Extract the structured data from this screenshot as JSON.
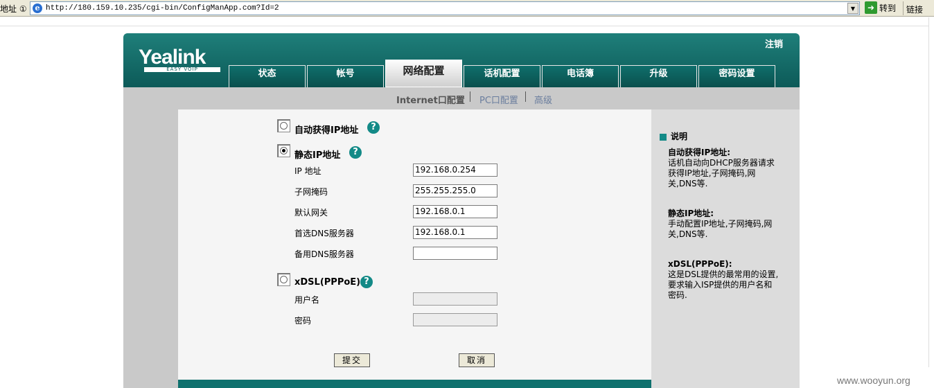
{
  "browser": {
    "address_label": "地址 ①",
    "url": "http://180.159.10.235/cgi-bin/ConfigManApp.com?Id=2",
    "go_label": "转到",
    "links_label": "链接"
  },
  "header": {
    "logo": "Yealink",
    "logo_sub": "EASY VOIP",
    "logout": "注销"
  },
  "tabs": [
    "状态",
    "帐号",
    "网络配置",
    "话机配置",
    "电话簿",
    "升级",
    "密码设置"
  ],
  "subnav": {
    "items": [
      "Internet口配置",
      "PC口配置",
      "高级"
    ],
    "current": "Internet口配置"
  },
  "form": {
    "dhcp_label": "自动获得IP地址",
    "static_label": "静态IP地址",
    "selected_mode": "static",
    "ip_label": "IP 地址",
    "ip_value": "192.168.0.254",
    "mask_label": "子网掩码",
    "mask_value": "255.255.255.0",
    "gateway_label": "默认网关",
    "gateway_value": "192.168.0.1",
    "dns1_label": "首选DNS服务器",
    "dns1_value": "192.168.0.1",
    "dns2_label": "备用DNS服务器",
    "dns2_value": "",
    "pppoe_label": "xDSL(PPPoE)",
    "user_label": "用户名",
    "user_value": "",
    "pass_label": "密码",
    "pass_value": "",
    "submit_label": "提交",
    "cancel_label": "取消",
    "help_glyph": "?"
  },
  "help_panel": {
    "title": "说明",
    "sections": [
      {
        "head": "自动获得IP地址:",
        "body": "话机自动向DHCP服务器请求获得IP地址,子网掩码,网关,DNS等."
      },
      {
        "head": "静态IP地址:",
        "body": "手动配置IP地址,子网掩码,网关,DNS等."
      },
      {
        "head": "xDSL(PPPoE):",
        "body": "这是DSL提供的最常用的设置,要求输入ISP提供的用户名和密码."
      }
    ]
  },
  "watermark": "www.wooyun.org",
  "colors": {
    "brand": "#0f716e",
    "panel": "#c9c9c9"
  }
}
